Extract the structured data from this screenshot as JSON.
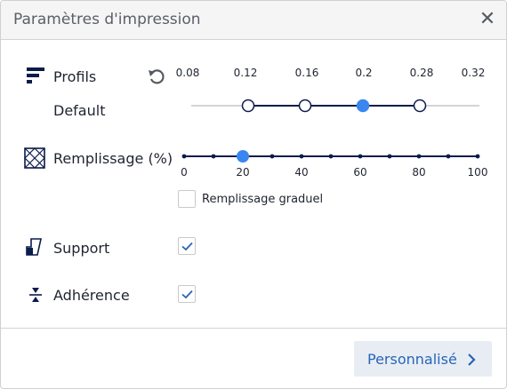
{
  "window": {
    "title": "Paramètres d'impression",
    "close_glyph": "✕"
  },
  "profiles": {
    "label": "Profils",
    "selected_name": "Default",
    "layer_heights": [
      "0.08",
      "0.12",
      "0.16",
      "0.2",
      "0.28",
      "0.32"
    ],
    "available": [
      "0.12",
      "0.16",
      "0.2",
      "0.28"
    ],
    "selected": "0.2",
    "icon": "profile-lines-icon",
    "reset_icon": "undo-icon"
  },
  "infill": {
    "label": "Remplissage (%)",
    "ticks": [
      "0",
      "20",
      "40",
      "60",
      "80",
      "100"
    ],
    "value": 20,
    "icon": "infill-grid-icon",
    "gradual_label": "Remplissage graduel",
    "gradual_checked": false
  },
  "support": {
    "label": "Support",
    "checked": true,
    "icon": "support-icon"
  },
  "adhesion": {
    "label": "Adhérence",
    "checked": true,
    "icon": "adhesion-icon"
  },
  "footer": {
    "custom_label": "Personnalisé",
    "chevron_icon": "chevron-right-icon"
  },
  "colors": {
    "accent": "#3a86f0",
    "track_dark": "#0b1c4a",
    "track_light": "#d4d4d4",
    "button_bg": "#e8edf4",
    "button_text": "#2765b8"
  }
}
